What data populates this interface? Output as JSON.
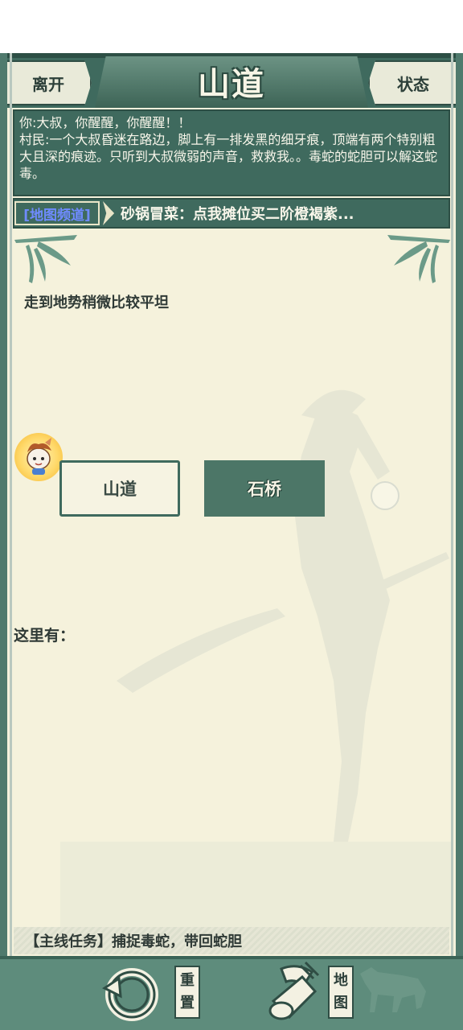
{
  "header": {
    "leave_label": "离开",
    "title": "山道",
    "status_label": "状态"
  },
  "messages": {
    "line1": "你:大叔，你醒醒，你醒醒！！",
    "line2": "村民:一个大叔昏迷在路边，脚上有一排发黑的细牙痕，顶端有两个特别粗大且深的痕迹。只听到大叔微弱的声音，救救我。。毒蛇的蛇胆可以解这蛇毒。"
  },
  "channel": {
    "tag": "[地图频道]",
    "text": "砂锅冒菜：点我摊位买二阶橙褐紫..."
  },
  "main": {
    "description": "走到地势稍微比较平坦",
    "current_location": "山道",
    "next_location": "石桥",
    "here_label": "这里有："
  },
  "quest": {
    "text": "【主线任务】捕捉毒蛇，带回蛇胆"
  },
  "bottom": {
    "reset_label_1": "重",
    "reset_label_2": "置",
    "map_label_1": "地",
    "map_label_2": "图"
  },
  "icons": {
    "reset": "rotate-arrow-icon",
    "map": "scroll-icon",
    "avatar": "rabbit-avatar-icon",
    "decor": "bamboo-icon"
  },
  "colors": {
    "primary": "#3f6a5e",
    "bar": "#5e8c7c",
    "paper": "#f5f2dc",
    "channel_tag": "#6f8bff"
  }
}
